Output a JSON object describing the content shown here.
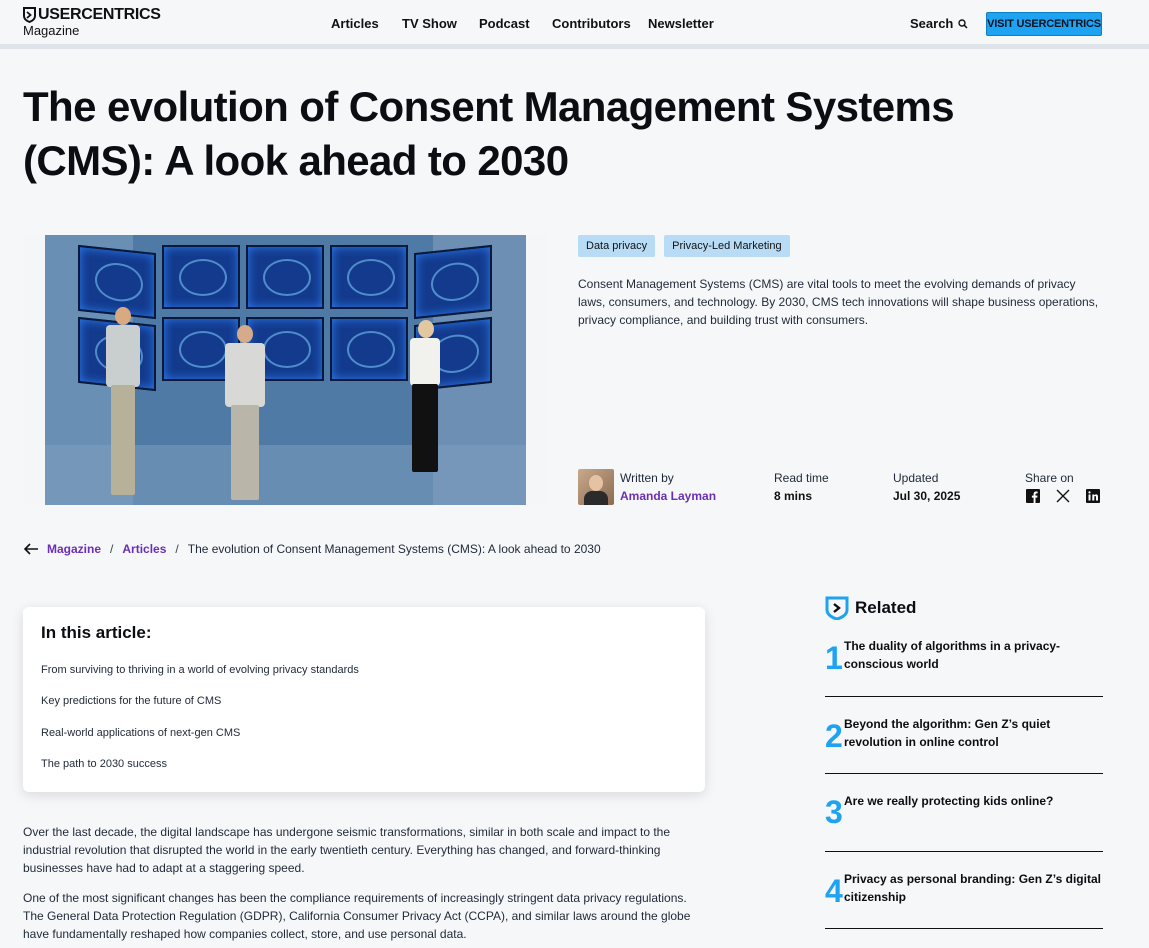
{
  "header": {
    "logo_text": "USERCENTRICS",
    "logo_sub": "Magazine",
    "nav": [
      "Articles",
      "TV Show",
      "Podcast",
      "Contributors",
      "Newsletter"
    ],
    "search_label": "Search",
    "cta_label": "VISIT USERCENTRICS"
  },
  "article": {
    "title": "The evolution of Consent Management Systems (CMS): A look ahead to 2030",
    "tags": [
      "Data privacy",
      "Privacy-Led Marketing"
    ],
    "intro": "Consent Management Systems (CMS) are vital tools to meet the evolving demands of privacy laws, consumers, and technology. By 2030, CMS tech innovations will shape business operations, privacy compliance, and building trust with consumers.",
    "written_by_label": "Written by",
    "author": "Amanda Layman",
    "read_time_label": "Read time",
    "read_time": "8 mins",
    "updated_label": "Updated",
    "updated": "Jul 30, 2025",
    "share_label": "Share on"
  },
  "breadcrumb": {
    "items": [
      "Magazine",
      "Articles"
    ],
    "current": "The evolution of Consent Management Systems (CMS): A look ahead to 2030"
  },
  "toc": {
    "title": "In this article:",
    "items": [
      "From surviving to thriving in a world of evolving privacy standards",
      "Key predictions for the future of CMS",
      "Real-world applications of next-gen CMS",
      "The path to 2030 success"
    ]
  },
  "body": {
    "paragraphs": [
      "Over the last decade, the digital landscape has undergone seismic transformations, similar in both scale and impact to the industrial revolution that disrupted the world in the early twentieth century. Everything has changed, and forward-thinking businesses have had to adapt at a staggering speed.",
      "One of the most significant changes has been the compliance requirements of increasingly stringent data privacy regulations. The General Data Protection Regulation (GDPR), California Consumer Privacy Act (CCPA), and similar laws around the globe have fundamentally reshaped how companies collect, store, and use personal data."
    ]
  },
  "related": {
    "title": "Related",
    "items": [
      {
        "num": "1",
        "title": "The duality of algorithms in a privacy-conscious world"
      },
      {
        "num": "2",
        "title": "Beyond the algorithm: Gen Z’s quiet revolution in online control"
      },
      {
        "num": "3",
        "title": "Are we really protecting kids online?"
      },
      {
        "num": "4",
        "title": "Privacy as personal branding: Gen Z’s digital citizenship"
      }
    ]
  },
  "colors": {
    "accent_blue": "#1ea3f2",
    "link_purple": "#6b2fb3",
    "tag_bg": "#b8dcf6",
    "page_bg": "#f6f7f9"
  },
  "icons": [
    "shield-logo-icon",
    "search-icon",
    "arrow-left-icon",
    "facebook-icon",
    "x-icon",
    "linkedin-icon",
    "related-shield-icon"
  ]
}
